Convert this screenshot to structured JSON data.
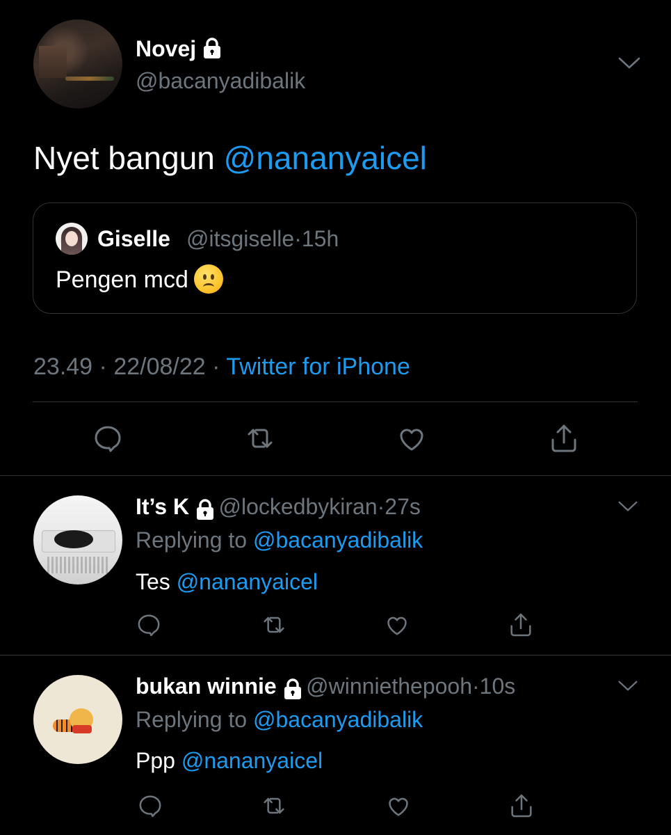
{
  "main_tweet": {
    "name": "Novej",
    "handle": "@bacanyadibalik",
    "text": "Nyet bangun",
    "mention": "@nananyaicel",
    "quote": {
      "name": "Giselle",
      "handle": "@itsgiselle",
      "time": "15h",
      "text": "Pengen mcd"
    },
    "time": "23.49",
    "date": "22/08/22",
    "source": "Twitter for iPhone"
  },
  "replies": [
    {
      "name": "It’s K",
      "handle": "@lockedbykiran",
      "time": "27s",
      "replying_label": "Replying to",
      "replying_to": "@bacanyadibalik",
      "text": "Tes",
      "mention": "@nananyaicel"
    },
    {
      "name": "bukan winnie",
      "handle": "@winniethepooh",
      "time": "10s",
      "replying_label": "Replying to",
      "replying_to": "@bacanyadibalik",
      "text": "Ppp",
      "mention": "@nananyaicel"
    }
  ],
  "separator": "·",
  "icons": {
    "lock": "lock-icon",
    "chevron": "chevron-down-icon",
    "reply": "reply-icon",
    "retweet": "retweet-icon",
    "like": "heart-icon",
    "share": "share-icon",
    "emoji": "slightly-frowning-face-emoji"
  },
  "colors": {
    "background": "#000000",
    "text": "#ffffff",
    "secondary": "#6e767d",
    "link": "#1d9bf0",
    "border": "#2f3336"
  }
}
